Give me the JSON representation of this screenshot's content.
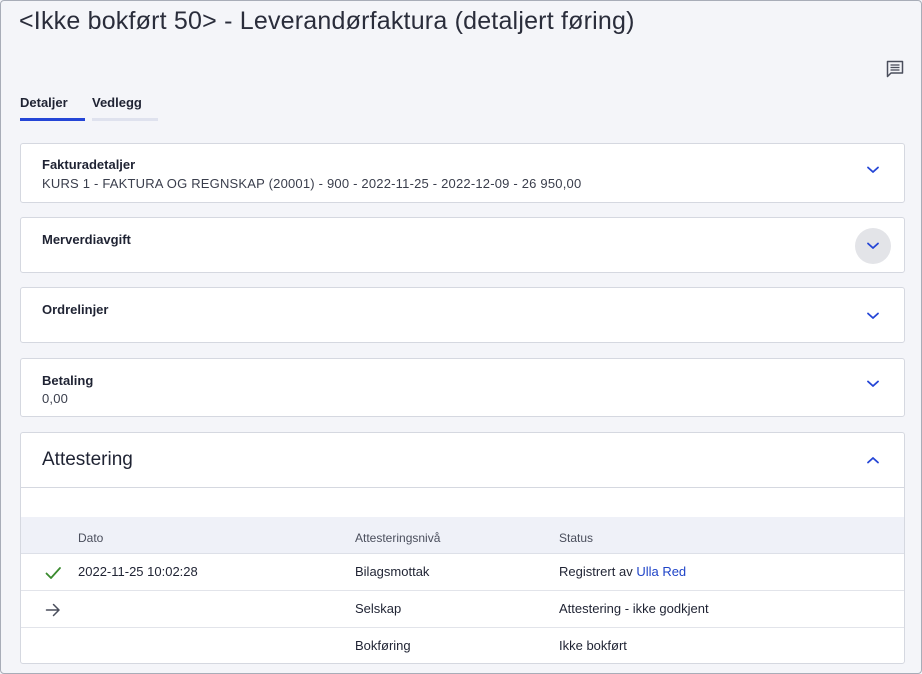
{
  "header": {
    "title": "<Ikke bokført 50> - Leverandørfaktura (detaljert føring)"
  },
  "icons": {
    "comment": "comment-icon",
    "expand": "chevron-down-icon",
    "collapse": "chevron-up-icon",
    "approved": "check-icon",
    "current": "arrow-right-icon"
  },
  "colors": {
    "accent": "#2445d6",
    "check": "#3a8a2e"
  },
  "tabs": [
    {
      "label": "Detaljer",
      "active": true
    },
    {
      "label": "Vedlegg",
      "active": false
    }
  ],
  "sections": {
    "fakturadetaljer": {
      "title": "Fakturadetaljer",
      "summary": "KURS 1 - FAKTURA OG REGNSKAP (20001)  -  900  -  2022-11-25  -  2022-12-09  -  26 950,00"
    },
    "merverdiavgift": {
      "title": "Merverdiavgift"
    },
    "ordrelinjer": {
      "title": "Ordrelinjer"
    },
    "betaling": {
      "title": "Betaling",
      "summary": "0,00"
    },
    "attestering": {
      "title": "Attestering"
    }
  },
  "attestering_table": {
    "columns": [
      "Dato",
      "Attesteringsnivå",
      "Status"
    ],
    "rows": [
      {
        "icon": "check-icon",
        "date": "2022-11-25 10:02:28",
        "level": "Bilagsmottak",
        "status_prefix": "Registrert av ",
        "status_link": "Ulla Red"
      },
      {
        "icon": "arrow-right-icon",
        "date": "",
        "level": "Selskap",
        "status": "Attestering - ikke godkjent"
      },
      {
        "icon": "",
        "date": "",
        "level": "Bokføring",
        "status": "Ikke bokført"
      }
    ]
  }
}
